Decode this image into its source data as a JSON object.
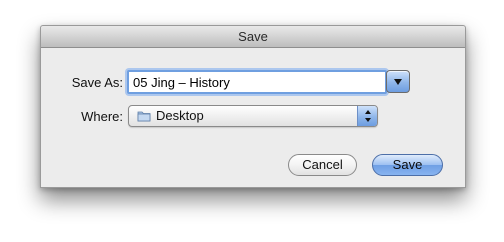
{
  "dialog": {
    "title": "Save",
    "save_as_label": "Save As:",
    "filename_value": "05 Jing – History",
    "where_label": "Where:",
    "where_selected": "Desktop",
    "cancel_label": "Cancel",
    "save_label": "Save"
  },
  "icons": {
    "expand": "triangle-down-icon",
    "folder": "folder-icon",
    "stepper": "updown-arrows-icon"
  },
  "colors": {
    "accent": "#6f9fe4",
    "focus_ring": "#6f9fe0",
    "sheet_bg": "#ececec"
  }
}
